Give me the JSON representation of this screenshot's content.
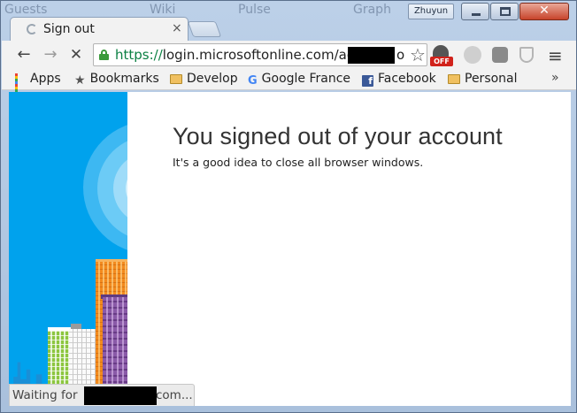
{
  "window": {
    "profile_name": "Zhuyun",
    "ghost_items": [
      "Guests",
      "Wiki",
      "Pulse",
      "Graph"
    ],
    "controls": {
      "minimize": "minimize",
      "maximize": "maximize",
      "close": "✕"
    }
  },
  "tab": {
    "title": "Sign out",
    "close_glyph": "×",
    "state": "loading"
  },
  "toolbar": {
    "back_glyph": "←",
    "forward_glyph": "→",
    "stop_glyph": "✕",
    "url_scheme": "https://",
    "url_rest": "login.microsoftonline.com/ad",
    "url_tail": "o",
    "star_glyph": "☆",
    "extension_off_label": "OFF",
    "menu_glyph": "≡"
  },
  "bookmarks": {
    "items": [
      {
        "label": "Apps",
        "icon": "apps-grid-icon"
      },
      {
        "label": "Bookmarks",
        "icon": "star-icon"
      },
      {
        "label": "Develop",
        "icon": "folder-icon"
      },
      {
        "label": "Google France",
        "icon": "google-icon"
      },
      {
        "label": "Facebook",
        "icon": "facebook-icon"
      },
      {
        "label": "Personal",
        "icon": "folder-icon"
      }
    ],
    "overflow_glyph": "»"
  },
  "page": {
    "heading": "You signed out of your account",
    "subtext": "It's a good idea to close all browser windows."
  },
  "status": {
    "prefix": "Waiting for",
    "suffix": "com..."
  },
  "colors": {
    "illustration_blue": "#00a2ed",
    "url_scheme_green": "#0b8043",
    "close_button_red": "#c7442b",
    "facebook_blue": "#3b5998"
  }
}
